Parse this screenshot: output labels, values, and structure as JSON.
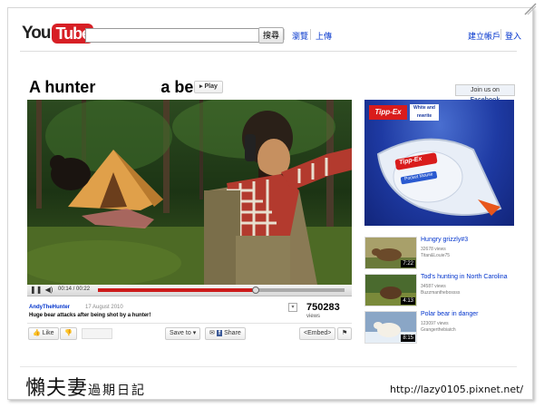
{
  "header": {
    "logo_you": "You",
    "logo_tube": "Tube",
    "search_button": "搜尋",
    "nav_browse": "瀏覽",
    "nav_upload": "上傳",
    "nav_create_account": "建立帳戶",
    "nav_login": "登入"
  },
  "video": {
    "title_part1": "A hunter",
    "title_part2": "a bear",
    "play_label": "▸ Play",
    "facebook_prefix": "Join us on ",
    "facebook_brand": "Facebook",
    "time_current": "00:14",
    "time_total": "00:22",
    "progress_fraction": 0.64,
    "uploader": "AndyTheHunter",
    "upload_date": "17 August 2010",
    "description": "Huge bear attacks after being shot by a hunter!",
    "views_count": "750283",
    "views_label": "views"
  },
  "actions": {
    "like": "Like",
    "save_to": "Save to",
    "share": "Share",
    "embed": "<Embed>"
  },
  "ad": {
    "brand": "Tipp-Ex",
    "tagline_line1": "White and",
    "tagline_line2": "rewrite",
    "product_label": "Tipp-Ex",
    "product_sub": "Pocket Mouse"
  },
  "related": [
    {
      "title": "Hungry grizzly#3",
      "views": "32678 views",
      "user": "Titan&Louie75",
      "duration": "7:22"
    },
    {
      "title": "Tod's hunting in North Carolina",
      "views": "34587 views",
      "user": "Buzzmanthebossss",
      "duration": "4:13"
    },
    {
      "title": "Polar bear in danger",
      "views": "123097 views",
      "user": "Grangerthebiatch",
      "duration": "8:15"
    }
  ],
  "watermark": {
    "main": "懶夫妻",
    "sub": "過期日記",
    "url": "http://lazy0105.pixnet.net/"
  },
  "colors": {
    "youtube_red": "#d71f25",
    "link_blue": "#0033cc",
    "progress_red": "#cc1a1a",
    "ad_blue": "#1e3aa3"
  }
}
